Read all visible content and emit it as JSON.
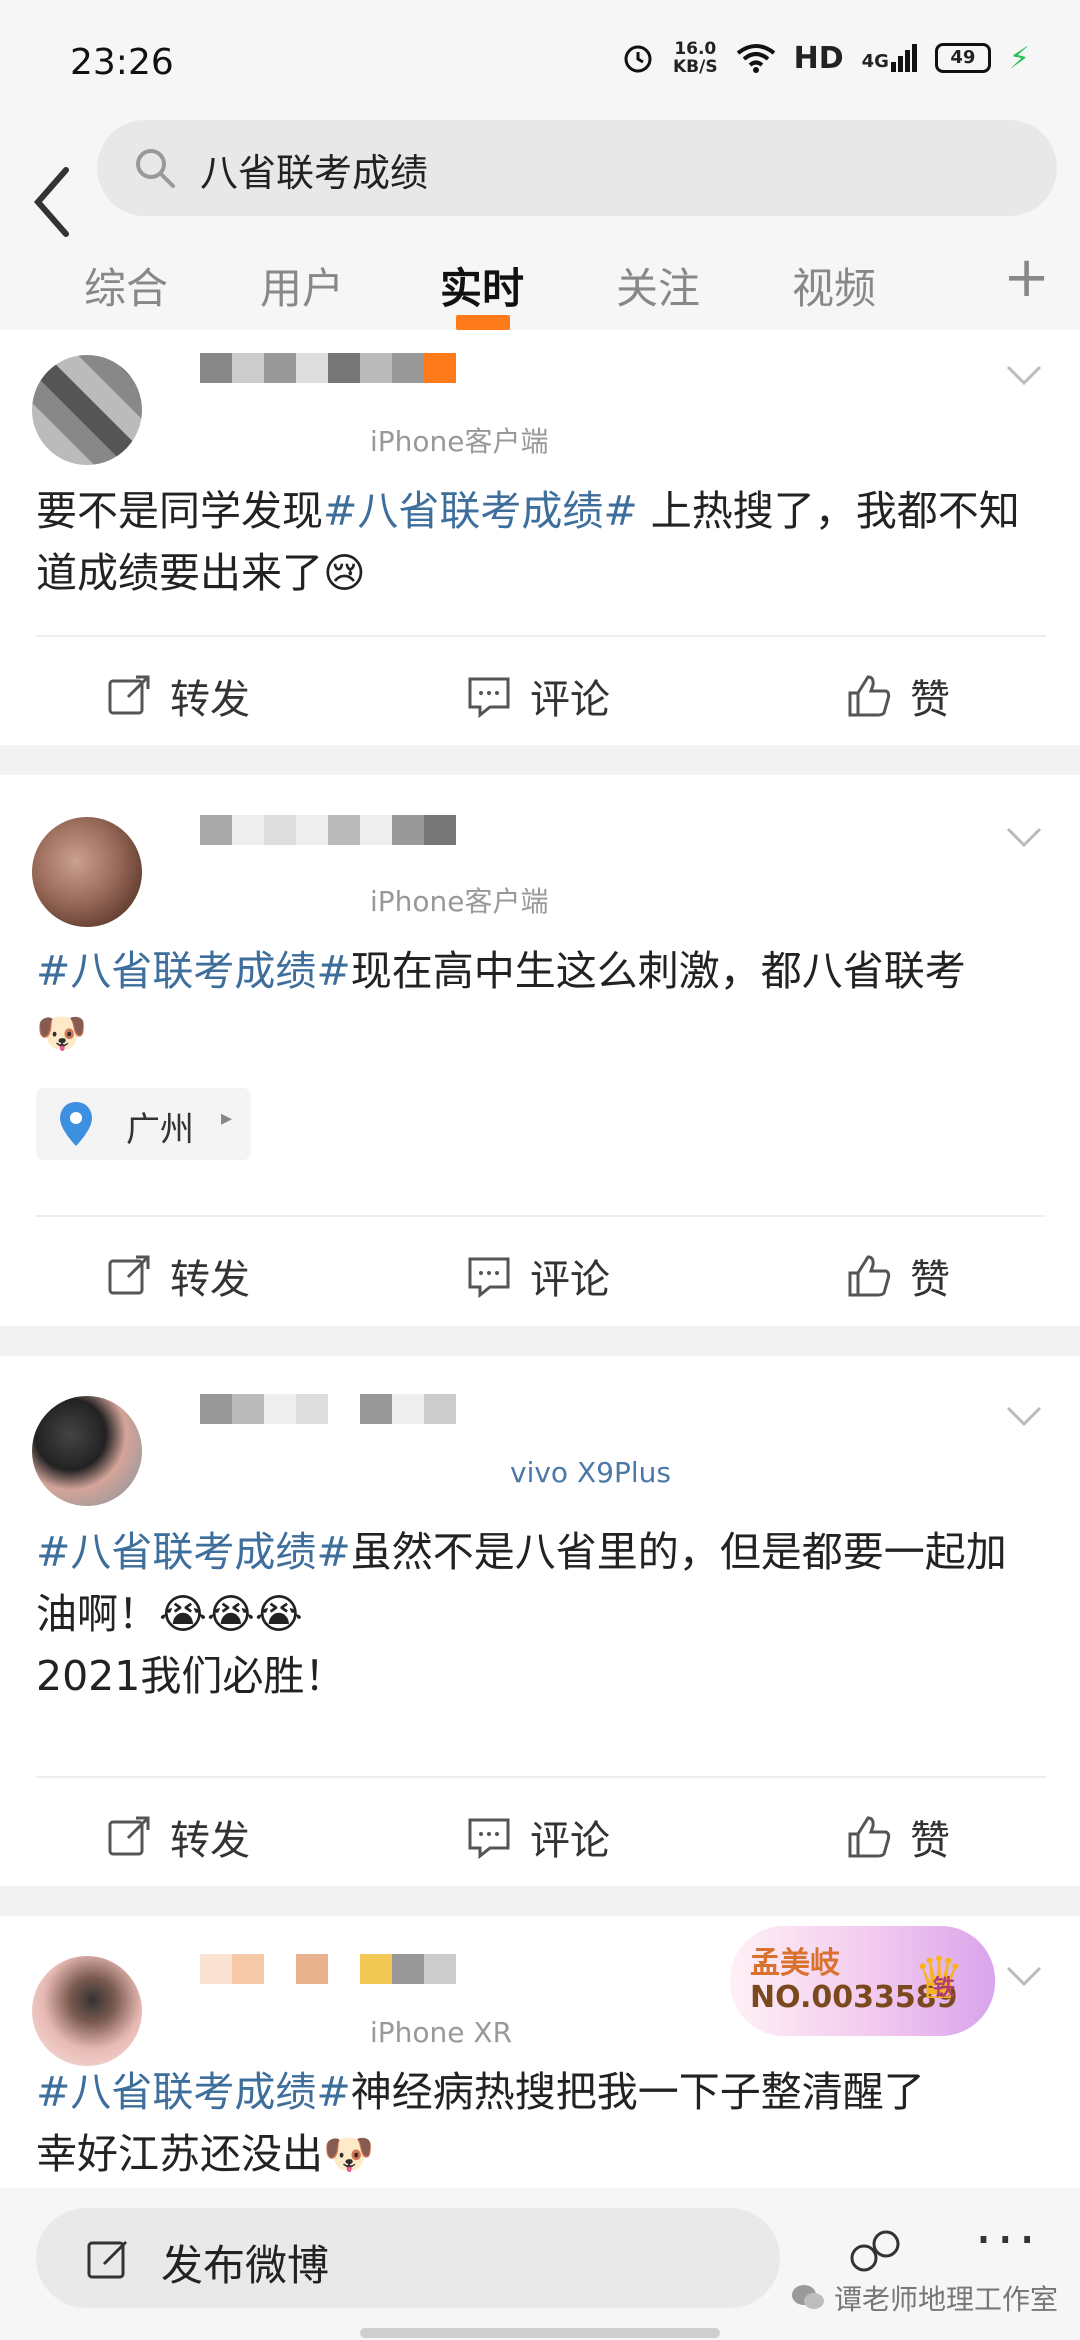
{
  "status_bar": {
    "time": "23:26",
    "net_speed_value": "16.0",
    "net_speed_unit": "KB/S",
    "hd": "HD",
    "network": "4G",
    "battery": "49"
  },
  "search": {
    "query": "八省联考成绩"
  },
  "tabs": [
    {
      "label": "综合"
    },
    {
      "label": "用户"
    },
    {
      "label": "实时"
    },
    {
      "label": "关注"
    },
    {
      "label": "视频"
    }
  ],
  "tabs_active_index": 2,
  "tabs_plus": "+",
  "actions": {
    "repost": "转发",
    "comment": "评论",
    "like": "赞"
  },
  "posts": [
    {
      "source": "iPhone客户端",
      "text_pre": "要不是同学发现",
      "hashtag": "#八省联考成绩#",
      "text_post": " 上热搜了，我都不知道成绩要出来了",
      "emoji": "😢"
    },
    {
      "source": "iPhone客户端",
      "hashtag": "#八省联考成绩#",
      "text_post": "现在高中生这么刺激，都八省联考",
      "emoji": "🐶",
      "location": "广州"
    },
    {
      "source": "vivo X9Plus",
      "hashtag": "#八省联考成绩#",
      "text_post": "虽然不是八省里的，但是都要一起加油啊！",
      "emoji": "😭😭😭",
      "line2": "2021我们必胜！"
    },
    {
      "source": "iPhone XR",
      "hashtag": "#八省联考成绩#",
      "text_post": "神经病热搜把我一下子整清醒了",
      "line2": "幸好江苏还没出",
      "emoji": "🐶",
      "badge_name": "孟美岐",
      "badge_no": "NO.0033589",
      "badge_icon": "铁"
    }
  ],
  "bottom": {
    "compose_label": "发布微博",
    "more": "···",
    "watermark": "谭老师地理工作室"
  }
}
